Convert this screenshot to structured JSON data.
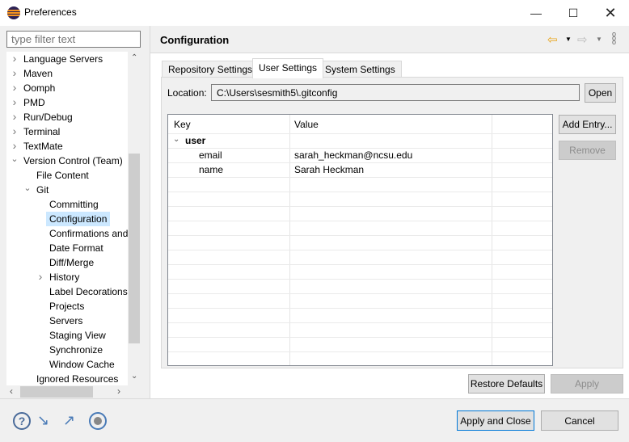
{
  "window": {
    "title": "Preferences",
    "controls": [
      "minimize",
      "maximize",
      "close"
    ]
  },
  "sidebar": {
    "filter_placeholder": "type filter text",
    "items": [
      {
        "label": "Language Servers",
        "level": 0,
        "expand": "collapsed"
      },
      {
        "label": "Maven",
        "level": 0,
        "expand": "collapsed"
      },
      {
        "label": "Oomph",
        "level": 0,
        "expand": "collapsed"
      },
      {
        "label": "PMD",
        "level": 0,
        "expand": "collapsed"
      },
      {
        "label": "Run/Debug",
        "level": 0,
        "expand": "collapsed"
      },
      {
        "label": "Terminal",
        "level": 0,
        "expand": "collapsed"
      },
      {
        "label": "TextMate",
        "level": 0,
        "expand": "collapsed"
      },
      {
        "label": "Version Control (Team)",
        "level": 0,
        "expand": "expanded"
      },
      {
        "label": "File Content",
        "level": 1,
        "expand": "none"
      },
      {
        "label": "Git",
        "level": 1,
        "expand": "expanded"
      },
      {
        "label": "Committing",
        "level": 2,
        "expand": "none"
      },
      {
        "label": "Configuration",
        "level": 2,
        "expand": "none",
        "selected": true
      },
      {
        "label": "Confirmations and",
        "level": 2,
        "expand": "none"
      },
      {
        "label": "Date Format",
        "level": 2,
        "expand": "none"
      },
      {
        "label": "Diff/Merge",
        "level": 2,
        "expand": "none"
      },
      {
        "label": "History",
        "level": 2,
        "expand": "collapsed"
      },
      {
        "label": "Label Decorations",
        "level": 2,
        "expand": "none"
      },
      {
        "label": "Projects",
        "level": 2,
        "expand": "none"
      },
      {
        "label": "Servers",
        "level": 2,
        "expand": "none"
      },
      {
        "label": "Staging View",
        "level": 2,
        "expand": "none"
      },
      {
        "label": "Synchronize",
        "level": 2,
        "expand": "none"
      },
      {
        "label": "Window Cache",
        "level": 2,
        "expand": "none"
      },
      {
        "label": "Ignored Resources",
        "level": 1,
        "expand": "none"
      }
    ]
  },
  "main": {
    "title": "Configuration",
    "tabs": [
      {
        "label": "Repository Settings"
      },
      {
        "label": "User Settings",
        "active": true
      },
      {
        "label": "System Settings"
      }
    ],
    "location_label": "Location:",
    "location_value": "C:\\Users\\sesmith5\\.gitconfig",
    "open_button": "Open",
    "table": {
      "headers": [
        "Key",
        "Value"
      ],
      "section": "user",
      "rows": [
        {
          "key": "email",
          "value": "sarah_heckman@ncsu.edu"
        },
        {
          "key": "name",
          "value": "Sarah Heckman"
        }
      ]
    },
    "add_entry_button": "Add Entry...",
    "remove_button": "Remove",
    "restore_defaults_button": "Restore Defaults",
    "apply_button": "Apply"
  },
  "footer": {
    "apply_close_button": "Apply and Close",
    "cancel_button": "Cancel",
    "icons": [
      "help-icon",
      "import-icon",
      "export-icon",
      "record-icon"
    ]
  },
  "colors": {
    "selection": "#cce8ff",
    "nav_back": "#e8a317",
    "default_button_border": "#0078d7"
  }
}
